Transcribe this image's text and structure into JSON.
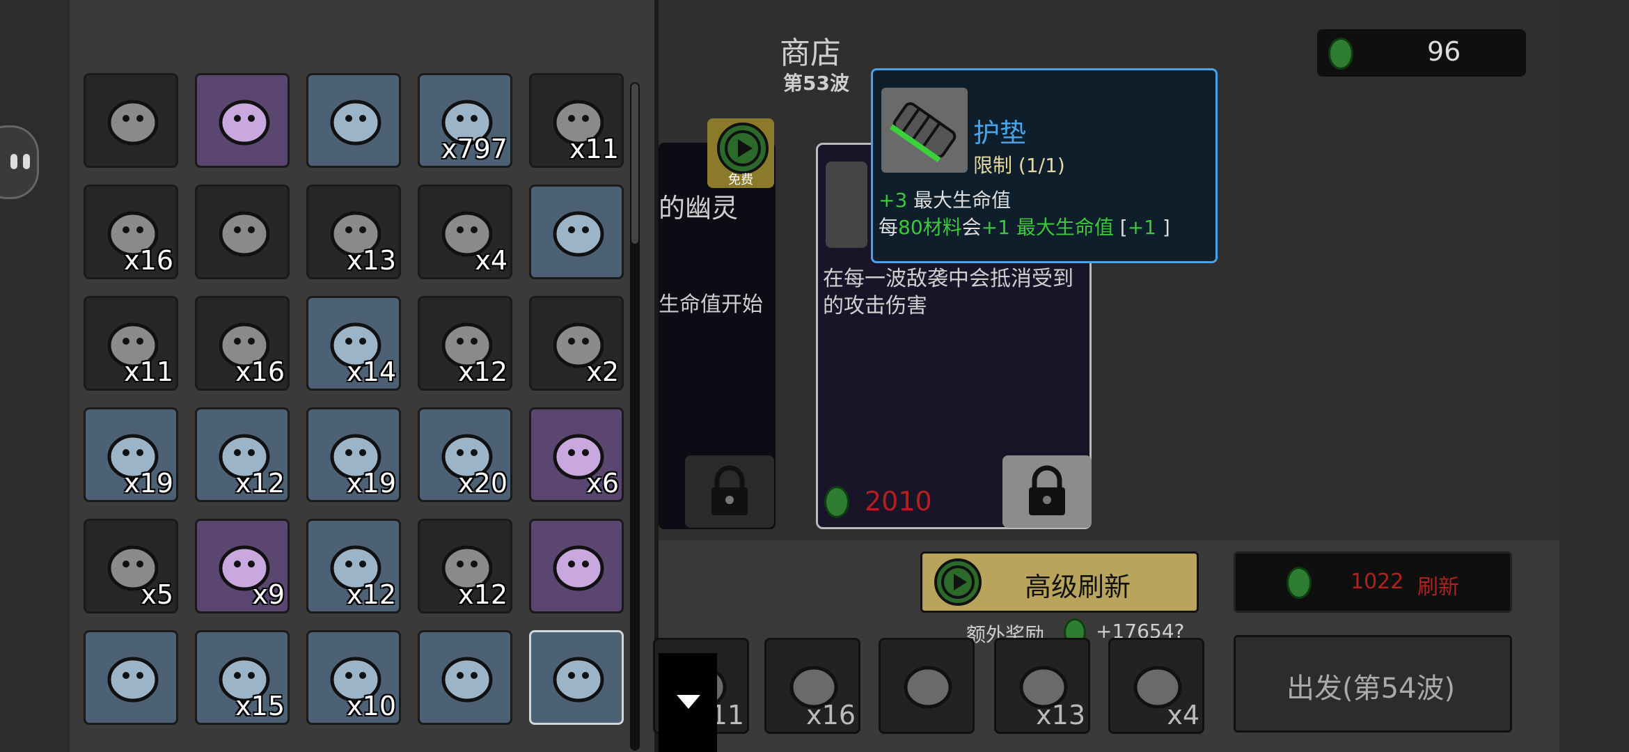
{
  "shop": {
    "title": "商店",
    "wave": "第53波",
    "materials": "96"
  },
  "inventory": {
    "rows": [
      [
        {
          "icon": "purple-ring-icon",
          "count": "",
          "bg": "gray"
        },
        {
          "icon": "round-shield-icon",
          "count": "",
          "bg": "purple"
        },
        {
          "icon": "clown-face-icon",
          "count": "",
          "bg": "blue"
        },
        {
          "icon": "lens-tool-icon",
          "count": "x797",
          "bg": "blue"
        },
        {
          "icon": "running-creature-icon",
          "count": "x11",
          "bg": "gray"
        }
      ],
      [
        {
          "icon": "glasses-icon",
          "count": "x16",
          "bg": "gray"
        },
        {
          "icon": "tooth-icon",
          "count": "",
          "bg": "gray"
        },
        {
          "icon": "tree-icon",
          "count": "x13",
          "bg": "gray"
        },
        {
          "icon": "meat-bone-icon",
          "count": "x4",
          "bg": "gray"
        },
        {
          "icon": "piggy-bank-icon",
          "count": "",
          "bg": "blue"
        }
      ],
      [
        {
          "icon": "bracelet-icon",
          "count": "x11",
          "bg": "gray"
        },
        {
          "icon": "ghost-cloak-icon",
          "count": "x16",
          "bg": "gray"
        },
        {
          "icon": "wheelbarrow-icon",
          "count": "x14",
          "bg": "blue"
        },
        {
          "icon": "plant-sack-icon",
          "count": "x12",
          "bg": "gray"
        },
        {
          "icon": "cake-slice-icon",
          "count": "x2",
          "bg": "gray"
        }
      ],
      [
        {
          "icon": "visor-icon",
          "count": "x19",
          "bg": "blue"
        },
        {
          "icon": "pumpkin-icon",
          "count": "x12",
          "bg": "blue"
        },
        {
          "icon": "armored-pad-icon",
          "count": "x19",
          "bg": "blue"
        },
        {
          "icon": "alien-rock-icon",
          "count": "x20",
          "bg": "blue"
        },
        {
          "icon": "wings-icon",
          "count": "x6",
          "bg": "purple"
        }
      ],
      [
        {
          "icon": "banknote-icon",
          "count": "x5",
          "bg": "gray"
        },
        {
          "icon": "mortar-pestle-icon",
          "count": "x9",
          "bg": "purple"
        },
        {
          "icon": "snail-icon",
          "count": "x12",
          "bg": "blue"
        },
        {
          "icon": "ghost-blob-icon",
          "count": "x12",
          "bg": "gray"
        },
        {
          "icon": "brain-icon",
          "count": "",
          "bg": "purple"
        }
      ],
      [
        {
          "icon": "ice-cube-icon",
          "count": "",
          "bg": "blue"
        },
        {
          "icon": "shovel-icon",
          "count": "x15",
          "bg": "blue"
        },
        {
          "icon": "red-cape-icon",
          "count": "x10",
          "bg": "blue"
        },
        {
          "icon": "ruined-house-icon",
          "count": "",
          "bg": "blue"
        },
        {
          "icon": "padding-icon",
          "count": "",
          "bg": "blue",
          "selected": true
        }
      ]
    ]
  },
  "card1": {
    "name": "的幽灵",
    "desc": "生命值开始",
    "free_label": "免费"
  },
  "card2": {
    "desc_line1": "在每一波敌袭中会抵消受到",
    "desc_line2": "的攻击伤害",
    "price": "2010"
  },
  "tooltip": {
    "name": "护垫",
    "limit": "限制 (1/1)",
    "line1_value": "+3",
    "line1_text": " 最大生命值",
    "line2_prefix": "每",
    "line2_amount": "80材料",
    "line2_mid": "会",
    "line2_value": "+1 最大生命值",
    "line2_bracket_open": " [",
    "line2_bracket_value": "+1",
    "line2_bracket_close": " ]"
  },
  "actions": {
    "advanced_refresh": "高级刷新",
    "refresh_cost": "1022",
    "refresh_label": "刷新",
    "bonus_label": "额外奖励",
    "bonus_value": "+17654?",
    "go_label": "出发(第54波)"
  },
  "bottom_items": [
    {
      "icon": "running-creature-icon",
      "count": "x11"
    },
    {
      "icon": "glasses-icon",
      "count": "x16"
    },
    {
      "icon": "tooth-icon",
      "count": ""
    },
    {
      "icon": "tree-icon",
      "count": "x13"
    },
    {
      "icon": "meat-bone-icon",
      "count": "x4"
    }
  ],
  "colors": {
    "green_stat": "#3cc83c",
    "tooltip_border": "#4aa3e8",
    "price_red": "#b32020",
    "gold_button": "#b8a45a"
  }
}
